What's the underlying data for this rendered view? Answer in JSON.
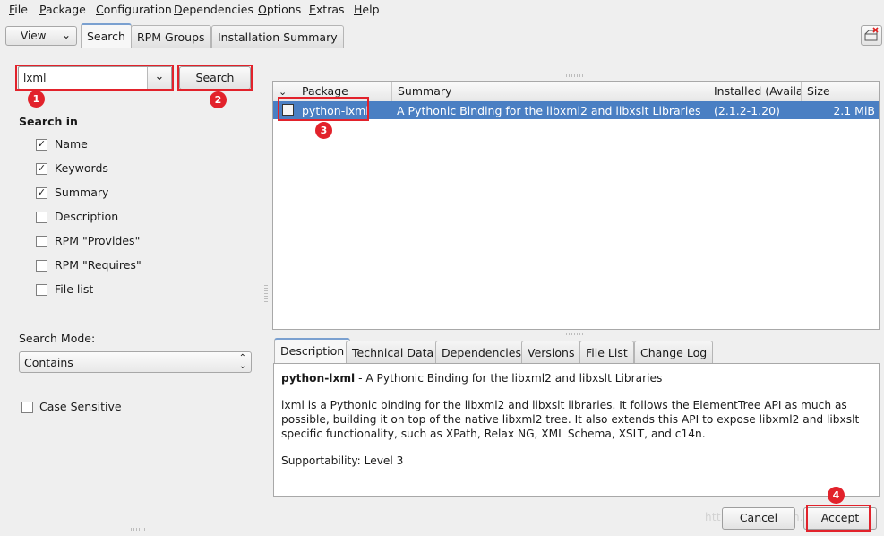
{
  "menubar": {
    "items": [
      {
        "u": "F",
        "rest": "ile"
      },
      {
        "u": "P",
        "rest": "ackage"
      },
      {
        "u": "C",
        "rest": "onfiguration"
      },
      {
        "u": "D",
        "rest": "ependencies"
      },
      {
        "u": "O",
        "rest": "ptions"
      },
      {
        "u": "E",
        "rest": "xtras"
      },
      {
        "u": "H",
        "rest": "elp"
      }
    ]
  },
  "toolbar": {
    "view_label": "View",
    "tabs": [
      "Search",
      "RPM Groups",
      "Installation Summary"
    ],
    "active_tab": "Search"
  },
  "search": {
    "query": "lxml",
    "button_label": "Search",
    "search_in_label": "Search in",
    "options": [
      {
        "label": "Name",
        "checked": true
      },
      {
        "label": "Keywords",
        "checked": true
      },
      {
        "label": "Summary",
        "checked": true
      },
      {
        "label": "Description",
        "checked": false
      },
      {
        "label": "RPM \"Provides\"",
        "checked": false
      },
      {
        "label": "RPM \"Requires\"",
        "checked": false
      },
      {
        "label": "File list",
        "checked": false
      }
    ],
    "mode_label": "Search Mode:",
    "mode_value": "Contains",
    "case_sensitive_label": "Case Sensitive",
    "case_sensitive": false
  },
  "package_table": {
    "columns": [
      "Package",
      "Summary",
      "Installed (Availab",
      "Size"
    ],
    "rows": [
      {
        "package": "python-lxml",
        "summary": "A Pythonic Binding for the libxml2 and libxslt Libraries",
        "installed": "(2.1.2-1.20)",
        "size": "2.1 MiB",
        "checked": false,
        "selected": true
      }
    ]
  },
  "details": {
    "tabs": [
      "Description",
      "Technical Data",
      "Dependencies",
      "Versions",
      "File List",
      "Change Log"
    ],
    "active_tab": "Description",
    "title": "python-lxml",
    "title_rest": " - A Pythonic Binding for the libxml2 and libxslt Libraries",
    "body": "lxml is a Pythonic binding for the libxml2 and libxslt libraries. It follows the ElementTree API as much as possible, building it on top of the native libxml2 tree. It also extends this API to expose libxml2 and libxslt specific functionality, such as XPath, Relax NG, XML Schema, XSLT, and c14n.",
    "supportability": "Supportability: Level 3"
  },
  "buttons": {
    "cancel": "Cancel",
    "accept": "Accept"
  },
  "annotations": [
    "1",
    "2",
    "3",
    "4"
  ],
  "colors": {
    "highlight": "#4a7fc3",
    "annotation_red": "#e2222b"
  }
}
